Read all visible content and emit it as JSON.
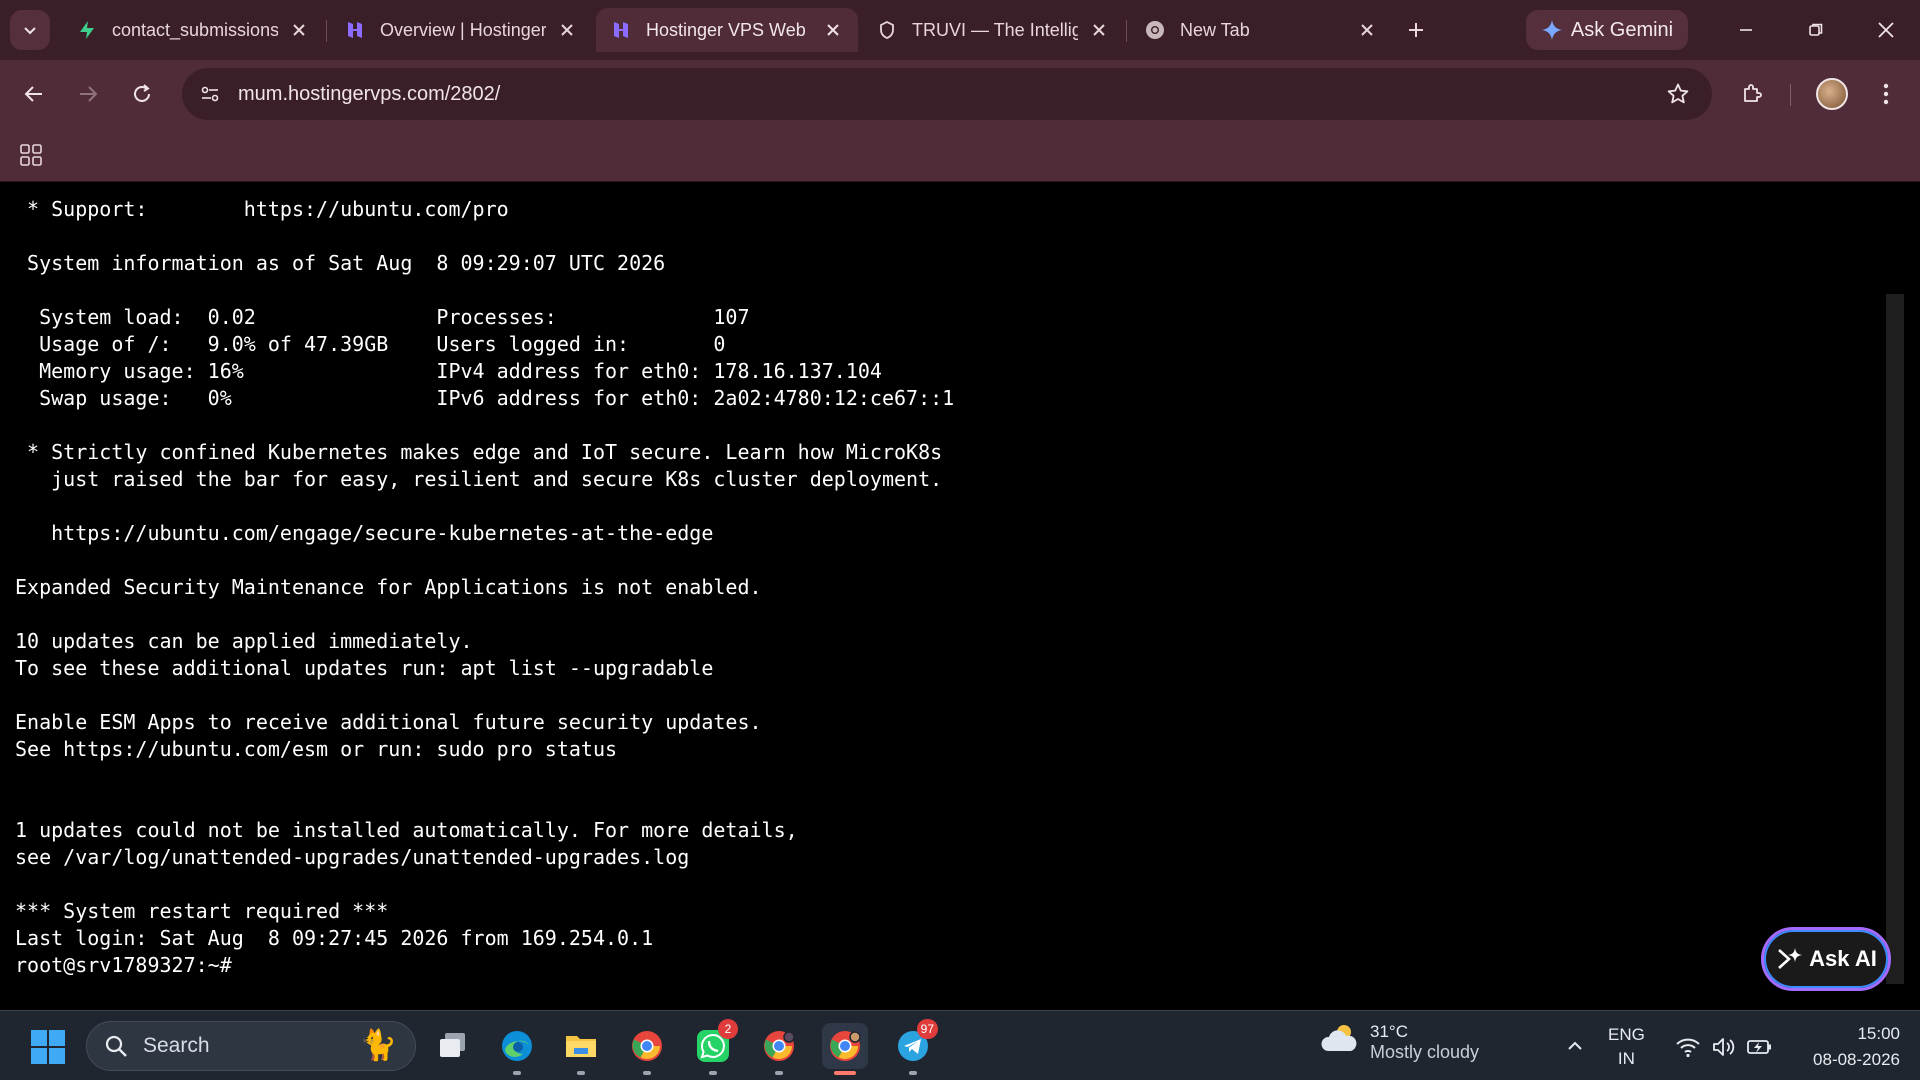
{
  "browser": {
    "tabs": [
      {
        "title": "contact_submissions",
        "favicon": "supabase-bolt-icon",
        "active": false
      },
      {
        "title": "Overview | Hostinger",
        "favicon": "hostinger-icon",
        "active": false
      },
      {
        "title": "Hostinger VPS Web",
        "favicon": "hostinger-icon",
        "active": true
      },
      {
        "title": "TRUVI — The Intellig",
        "favicon": "shield-icon",
        "active": false
      },
      {
        "title": "New Tab",
        "favicon": "chrome-icon",
        "active": false
      }
    ],
    "gemini_label": "Ask Gemini",
    "url": "mum.hostingervps.com/2802/"
  },
  "terminal": {
    "lines": [
      " * Support:        https://ubuntu.com/pro",
      "",
      " System information as of Sat Aug  8 09:29:07 UTC 2026",
      "",
      "  System load:  0.02               Processes:             107",
      "  Usage of /:   9.0% of 47.39GB    Users logged in:       0",
      "  Memory usage: 16%                IPv4 address for eth0: 178.16.137.104",
      "  Swap usage:   0%                 IPv6 address for eth0: 2a02:4780:12:ce67::1",
      "",
      " * Strictly confined Kubernetes makes edge and IoT secure. Learn how MicroK8s",
      "   just raised the bar for easy, resilient and secure K8s cluster deployment.",
      "",
      "   https://ubuntu.com/engage/secure-kubernetes-at-the-edge",
      "",
      "Expanded Security Maintenance for Applications is not enabled.",
      "",
      "10 updates can be applied immediately.",
      "To see these additional updates run: apt list --upgradable",
      "",
      "Enable ESM Apps to receive additional future security updates.",
      "See https://ubuntu.com/esm or run: sudo pro status",
      "",
      "",
      "1 updates could not be installed automatically. For more details,",
      "see /var/log/unattended-upgrades/unattended-upgrades.log",
      "",
      "*** System restart required ***",
      "Last login: Sat Aug  8 09:27:45 2026 from 169.254.0.1",
      "root@srv1789327:~#"
    ],
    "ask_ai_label": "Ask AI"
  },
  "taskbar": {
    "search_placeholder": "Search",
    "apps": [
      {
        "name": "task-view-icon"
      },
      {
        "name": "edge-icon"
      },
      {
        "name": "file-explorer-icon"
      },
      {
        "name": "chrome-icon"
      },
      {
        "name": "whatsapp-icon",
        "badge": "2"
      },
      {
        "name": "chrome-profile-icon"
      },
      {
        "name": "chrome-active-icon"
      },
      {
        "name": "telegram-icon",
        "badge": "97"
      }
    ],
    "weather": {
      "temp": "31°C",
      "condition": "Mostly cloudy"
    },
    "lang": {
      "line1": "ENG",
      "line2": "IN"
    },
    "clock": {
      "time": "15:00",
      "date": "08-08-2026"
    }
  },
  "colors": {
    "tab_strip": "#3b1f28",
    "toolbar": "#4f2c38",
    "terminal_bg": "#000000",
    "terminal_fg": "#ffffff",
    "taskbar": "#1f2630"
  }
}
